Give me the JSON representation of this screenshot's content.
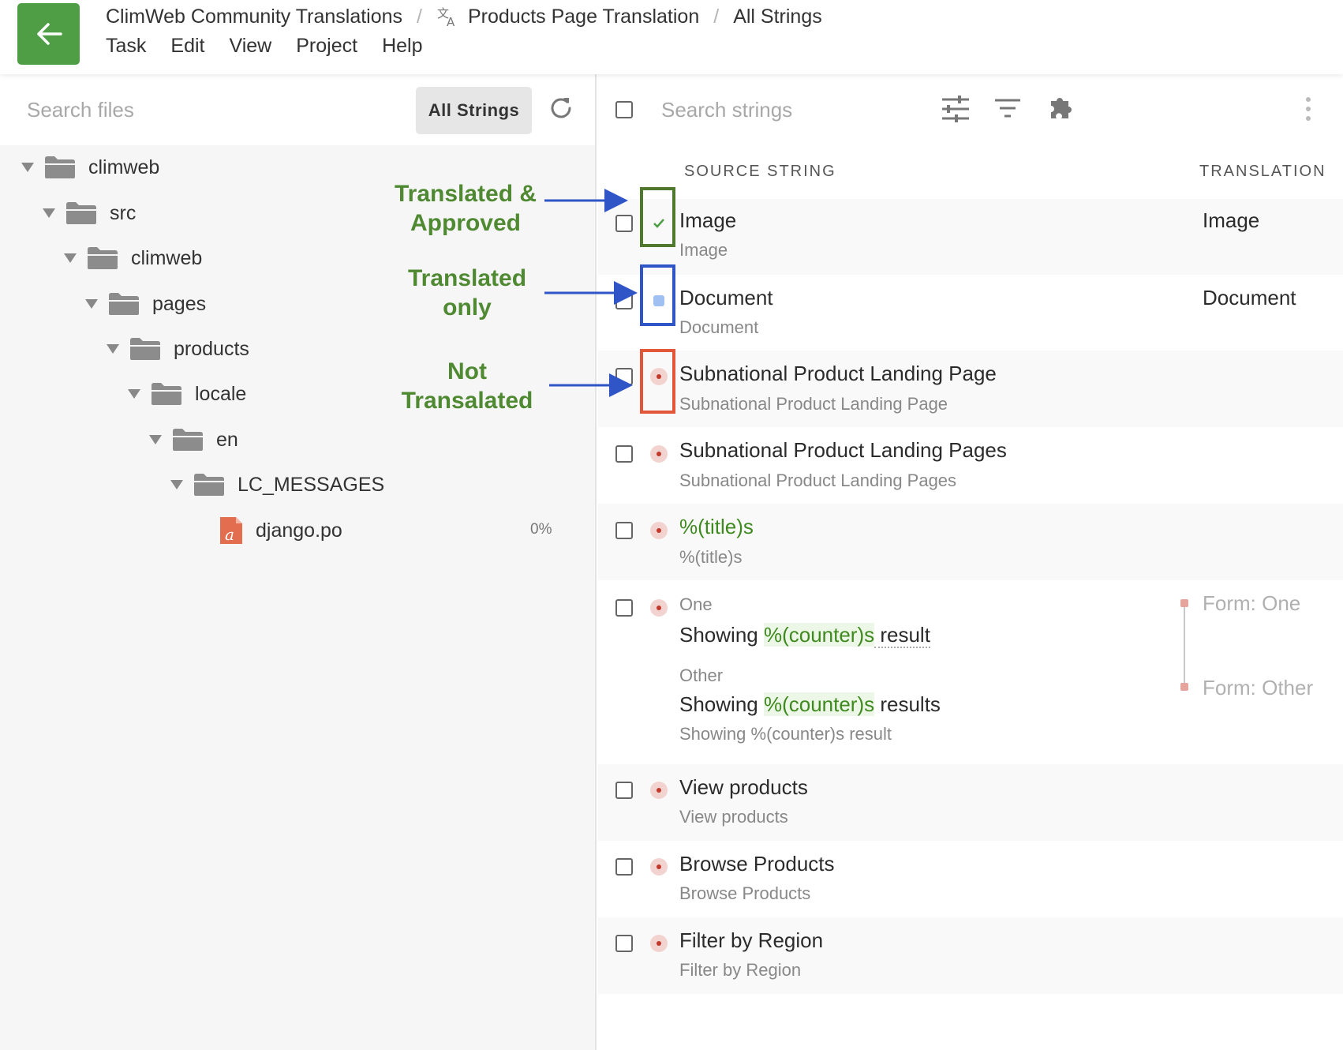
{
  "header": {
    "back_icon": "arrow-left-icon",
    "breadcrumb": [
      "ClimWeb Community Translations",
      "Products Page Translation",
      "All Strings"
    ],
    "separator": "/",
    "menu": [
      "Task",
      "Edit",
      "View",
      "Project",
      "Help"
    ],
    "accent": "#4f9d45"
  },
  "files": {
    "search_placeholder": "Search files",
    "all_strings_label": "All Strings",
    "tree": [
      "climweb",
      "src",
      "climweb",
      "pages",
      "products",
      "locale",
      "en",
      "LC_MESSAGES",
      "django.po"
    ],
    "file_percent": "0%"
  },
  "annotations": {
    "approved_line1": "Translated  &",
    "approved_line2": "Approved",
    "translated_line1": "Translated",
    "translated_line2": "only",
    "not_line1": "Not",
    "not_line2": "Transalated",
    "colors": {
      "approved": "#4f7a2e",
      "translated": "#2f55c6",
      "not": "#e2573a",
      "arrow": "#2f55c6"
    }
  },
  "strings": {
    "search_placeholder": "Search strings",
    "col_source": "SOURCE STRING",
    "col_translation": "TRANSLATION",
    "rows": [
      {
        "status": "approved",
        "source": "Image",
        "sub": "Image",
        "translation": "Image"
      },
      {
        "status": "translated",
        "source": "Document",
        "sub": "Document",
        "translation": "Document"
      },
      {
        "status": "not-translated",
        "source": "Subnational Product Landing Page",
        "sub": "Subnational Product Landing Page",
        "translation": ""
      },
      {
        "status": "not-translated",
        "source": "Subnational Product Landing Pages",
        "sub": "Subnational Product Landing Pages",
        "translation": ""
      },
      {
        "status": "not-translated",
        "source": "%(title)s",
        "sub": "%(title)s",
        "translation": ""
      },
      {
        "status": "not-translated",
        "one_label": "One",
        "one_pre": "Showing ",
        "one_ph": "%(counter)s",
        "one_post": " result",
        "other_label": "Other",
        "other_pre": "Showing ",
        "other_ph": "%(counter)s",
        "other_post": " results",
        "sub": "Showing %(counter)s result",
        "form_one": "Form: One",
        "form_other": "Form: Other"
      },
      {
        "status": "not-translated",
        "source": "View products",
        "sub": "View products",
        "translation": ""
      },
      {
        "status": "not-translated",
        "source": "Browse Products",
        "sub": "Browse Products",
        "translation": ""
      },
      {
        "status": "not-translated",
        "source": "Filter by Region",
        "sub": "Filter by Region",
        "translation": ""
      }
    ]
  }
}
